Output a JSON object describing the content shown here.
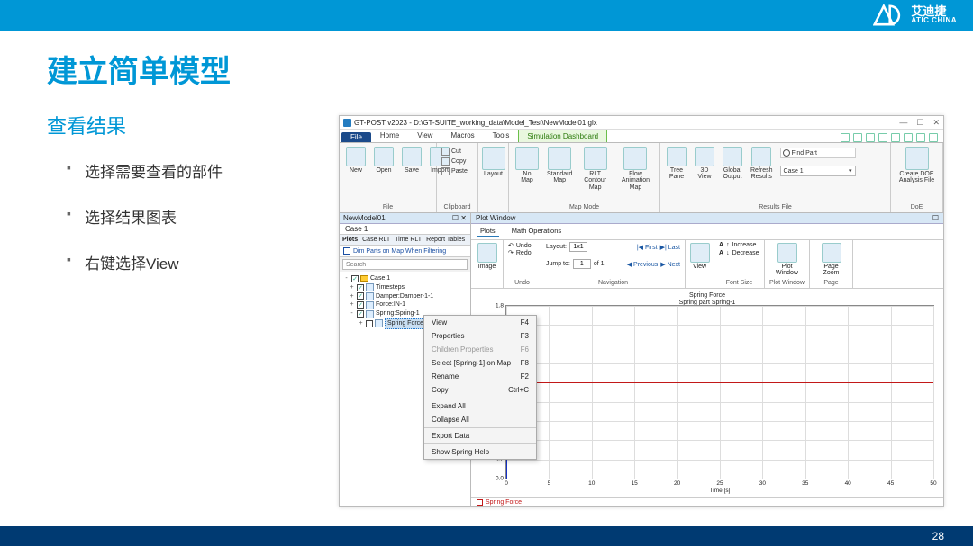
{
  "slide": {
    "title": "建立简单模型",
    "subtitle": "查看结果",
    "bullets": [
      "选择需要查看的部件",
      "选择结果图表",
      "右键选择View"
    ],
    "page_num": "28",
    "logo_cn": "艾迪捷",
    "logo_en": "ATIC CHINA"
  },
  "app": {
    "title": "GT-POST v2023 - D:\\GT-SUITE_working_data\\Model_Test\\NewModel01.glx",
    "file_tab": "File",
    "tabs": [
      "Home",
      "View",
      "Macros",
      "Tools"
    ],
    "sim_tab": "Simulation Dashboard",
    "ribbon": {
      "file": {
        "btns": [
          "New",
          "Open",
          "Save",
          "Import"
        ],
        "label": "File"
      },
      "clip": {
        "cut": "Cut",
        "copy": "Copy",
        "paste": "Paste",
        "label": "Clipboard"
      },
      "layout": {
        "btn": "Layout",
        "label": ""
      },
      "mapmode": {
        "btns": [
          "No\nMap",
          "Standard\nMap",
          "RLT Contour\nMap",
          "Flow Animation\nMap"
        ],
        "label": "Map Mode"
      },
      "results": {
        "btns": [
          "Tree\nPane",
          "3D\nView",
          "Global\nOutput",
          "Refresh\nResults"
        ],
        "find": "Find Part",
        "case": "Case 1",
        "label": "Results File"
      },
      "doe": {
        "btn": "Create DOE\nAnalysis File",
        "label": "DoE"
      }
    },
    "left": {
      "title": "NewModel01",
      "case": "Case 1",
      "plots_tabs": [
        "Plots",
        "Case RLT",
        "Time RLT",
        "Report Tables"
      ],
      "dim": "Dim Parts on Map When Filtering",
      "search_ph": "Search",
      "tree": {
        "root": "Case 1",
        "items": [
          "Timesteps",
          "Damper:Damper-1-1",
          "Force:IN-1",
          "Spring:Spring-1"
        ],
        "leaf": "Spring Force"
      }
    },
    "ctx": [
      {
        "l": "View",
        "k": "F4"
      },
      {
        "l": "Properties",
        "k": "F3"
      },
      {
        "l": "Children Properties",
        "k": "F6",
        "dis": true
      },
      {
        "l": "Select [Spring-1] on Map",
        "k": "F8"
      },
      {
        "l": "Rename",
        "k": "F2"
      },
      {
        "l": "Copy",
        "k": "Ctrl+C"
      },
      {
        "sep": true
      },
      {
        "l": "Expand All",
        "k": ""
      },
      {
        "l": "Collapse All",
        "k": ""
      },
      {
        "sep": true
      },
      {
        "l": "Export Data",
        "k": ""
      },
      {
        "sep": true
      },
      {
        "l": "Show Spring Help",
        "k": ""
      }
    ],
    "plot": {
      "win_title": "Plot Window",
      "tabs": [
        "Plots",
        "Math Operations"
      ],
      "undo": "Undo",
      "redo": "Redo",
      "image": "Image",
      "layout_lbl": "Layout:",
      "layout_val": "1x1",
      "jump_lbl": "Jump to:",
      "jump_val": "1",
      "of": "of 1",
      "first": "First",
      "last": "Last",
      "prev": "Previous",
      "next": "Next",
      "nav_label": "Navigation",
      "undo_label": "Undo",
      "view": "View",
      "inc": "Increase",
      "dec": "Decrease",
      "fs_label": "Font Size",
      "plotwin_btn": "Plot Window",
      "plotwin_label": "Plot Window",
      "pagezoom": "Page Zoom",
      "page_label": "Page",
      "chart_title1": "Spring Force",
      "chart_title2": "Spring part Spring-1",
      "xlabel": "Time [s]",
      "bottom_tab": "Spring Force"
    }
  },
  "chart_data": {
    "type": "line",
    "title": "Spring Force — Spring part Spring-1",
    "xlabel": "Time [s]",
    "ylabel": "",
    "xlim": [
      0,
      50
    ],
    "ylim": [
      0.0,
      1.8
    ],
    "xticks": [
      0,
      5,
      10,
      15,
      20,
      25,
      30,
      35,
      40,
      45,
      50
    ],
    "yticks": [
      0.0,
      0.2,
      1.8
    ],
    "series": [
      {
        "name": "Spring Force (red)",
        "x": [
          0,
          50
        ],
        "y": [
          1.0,
          1.0
        ]
      },
      {
        "name": "Series 2 (blue)",
        "x": [
          0,
          0
        ],
        "y": [
          0.0,
          0.2
        ]
      }
    ]
  }
}
